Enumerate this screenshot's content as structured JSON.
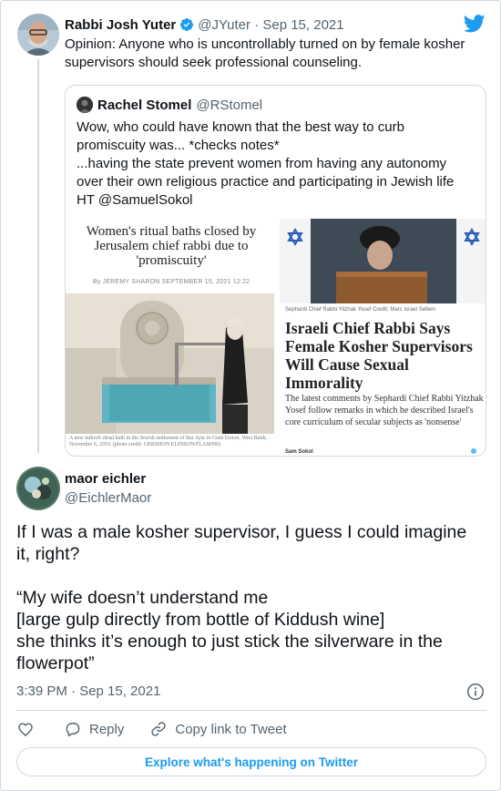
{
  "parent_tweet": {
    "author_name": "Rabbi Josh Yuter",
    "handle_date": "@JYuter · Sep 15, 2021",
    "text_lines": [
      "Opinion: Anyone who is uncontrollably turned on by female kosher",
      "supervisors should seek professional counseling."
    ],
    "verified_icon": "verified-badge-icon"
  },
  "quoted_tweet": {
    "author_name": "Rachel Stomel",
    "handle": "@RStomel",
    "text_lines": [
      "Wow, who could have known that the best way to curb",
      "promiscuity was... *checks notes*",
      "...having the state prevent women from having any autonomy",
      "over their own religious practice and participating in Jewish life",
      "HT @SamuelSokol"
    ],
    "media_left": {
      "headline": "Women's ritual baths closed by Jerusalem chief rabbi due to 'promiscuity'",
      "byline": "By JEREMY SHARON   SEPTEMBER 15, 2021 12:22",
      "caption": "A new mikveh ritual bath in the Jewish settlement of Bat Ayin in Gush Etzion, West Bank, November 6, 2019. (photo credit: GERSHON ELINSON/FLASH90)"
    },
    "media_right": {
      "credit": "Sephardi Chief Rabbi Yitzhak Yosef   Credit: Marc Israel Sellem",
      "headline": "Israeli Chief Rabbi Says Female Kosher Supervisors Will Cause Sexual Immorality",
      "body": "The latest comments by Sephardi Chief Rabbi Yitzhak Yosef follow remarks in which he described Israel's core curriculum of secular subjects as 'nonsense'",
      "author": "Sam Sokol"
    }
  },
  "main_tweet": {
    "author_name": "maor eichler",
    "handle": "@EichlerMaor",
    "text_lines": [
      "If I was a male kosher supervisor, I guess I could imagine",
      "it, right?",
      "",
      "“My wife doesn’t understand me",
      "[large gulp directly from bottle of Kiddush wine]",
      "she thinks it’s enough to just stick the silverware in the",
      "flowerpot”"
    ],
    "timestamp": "3:39 PM · Sep 15, 2021"
  },
  "actions": {
    "like_icon": "heart-icon",
    "reply_label": "Reply",
    "copy_label": "Copy link to Tweet"
  },
  "explore_label": "Explore what's happening on Twitter",
  "colors": {
    "accent": "#1d9bf0",
    "text": "#0f1419",
    "secondary": "#536471",
    "border": "#cfd9de"
  }
}
